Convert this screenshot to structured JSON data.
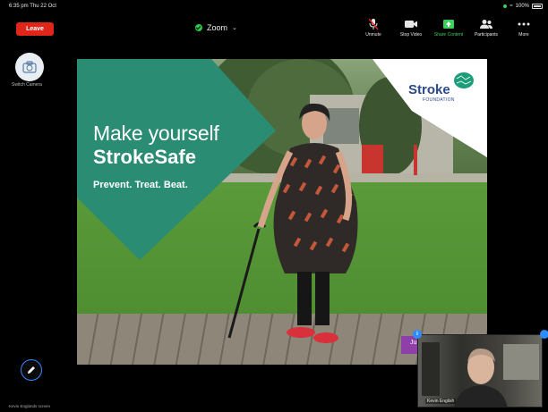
{
  "status_bar": {
    "time": "6:35 pm  Thu 22 Oct",
    "battery": "100%"
  },
  "toolbar": {
    "leave_label": "Leave",
    "meeting_title": "Zoom",
    "tools": [
      {
        "icon": "mic-off-icon",
        "label": "Unmute"
      },
      {
        "icon": "video-icon",
        "label": "Stop Video"
      },
      {
        "icon": "share-screen-icon",
        "label": "Share Content"
      },
      {
        "icon": "participants-icon",
        "label": "Participants"
      },
      {
        "icon": "more-icon",
        "label": "More"
      }
    ]
  },
  "gallery": {
    "self_label": "Switch Camera",
    "bottom_label": "Kevin Englands screen"
  },
  "slide": {
    "headline_line1": "Make yourself",
    "headline_line2": "StrokeSafe",
    "tagline": "Prevent. Treat. Beat.",
    "logo_name": "Stroke",
    "logo_sub": "FOUNDATION",
    "name_tag": "Ju"
  },
  "speaker": {
    "name": "Kevin English",
    "badge": "i"
  },
  "colors": {
    "teal": "#2a8c73",
    "leave_red": "#e0261b",
    "zoom_blue": "#2d8cff",
    "share_green": "#3ad05a",
    "logo_blue": "#2b4a8c"
  }
}
